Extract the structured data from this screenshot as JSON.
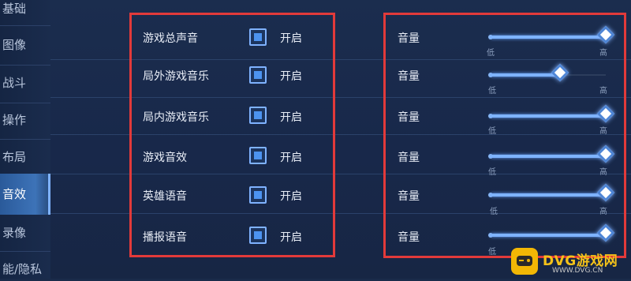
{
  "sidebar": {
    "items": [
      {
        "label": "基础"
      },
      {
        "label": "图像"
      },
      {
        "label": "战斗"
      },
      {
        "label": "操作"
      },
      {
        "label": "布局"
      },
      {
        "label": "音效",
        "active": true
      },
      {
        "label": "录像"
      },
      {
        "label": "能/隐私"
      }
    ]
  },
  "audio_options": [
    {
      "label": "游戏总声音",
      "state": "开启",
      "checked": true
    },
    {
      "label": "局外游戏音乐",
      "state": "开启",
      "checked": true
    },
    {
      "label": "局内游戏音乐",
      "state": "开启",
      "checked": true
    },
    {
      "label": "游戏音效",
      "state": "开启",
      "checked": true
    },
    {
      "label": "英雄语音",
      "state": "开启",
      "checked": true
    },
    {
      "label": "播报语音",
      "state": "开启",
      "checked": true
    }
  ],
  "volume_sliders": [
    {
      "label": "音量",
      "low": "低",
      "high": "高",
      "level": 1.0
    },
    {
      "label": "音量",
      "low": "低",
      "high": "高",
      "level": 0.6
    },
    {
      "label": "音量",
      "low": "低",
      "high": "高",
      "level": 1.0
    },
    {
      "label": "音量",
      "low": "低",
      "high": "高",
      "level": 1.0
    },
    {
      "label": "音量",
      "low": "低",
      "high": "高",
      "level": 1.0
    },
    {
      "label": "音量",
      "low": "低",
      "high": "高",
      "level": 1.0
    }
  ],
  "watermark": {
    "brand": "DVG游戏网",
    "site": "WWW.DVG.CN"
  },
  "colors": {
    "highlight": "#e23a3a",
    "accent": "#7eb3ff",
    "active_tab": "#3d73b8"
  }
}
